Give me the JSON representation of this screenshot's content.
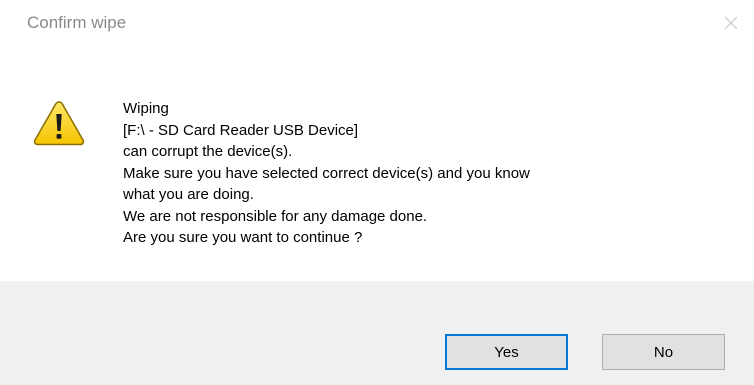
{
  "window": {
    "title": "Confirm wipe",
    "close_icon": "close-icon"
  },
  "message": {
    "icon": "warning-icon",
    "lines": [
      "Wiping",
      "[F:\\ - SD Card Reader USB Device]",
      "can corrupt the device(s).",
      "Make sure you have selected correct device(s) and you know",
      "what you are doing.",
      "We are not responsible for any damage done.",
      "Are you sure you want to continue ?"
    ]
  },
  "buttons": {
    "yes_label": "Yes",
    "no_label": "No",
    "default": "yes"
  },
  "colors": {
    "footer_bg": "#f0f0f0",
    "button_bg": "#e1e1e1",
    "focus_border": "#0078d7",
    "title_text": "#8a8a8a"
  }
}
